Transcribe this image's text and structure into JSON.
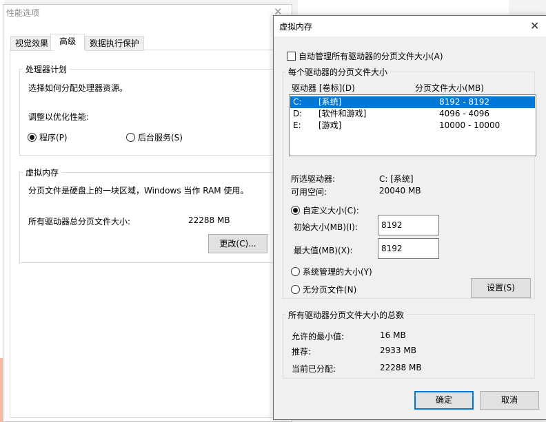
{
  "perf_window": {
    "title": "性能选项",
    "tabs": [
      "视觉效果",
      "高级",
      "数据执行保护"
    ],
    "cpu_group": {
      "title": "处理器计划",
      "description": "选择如何分配处理器资源。",
      "adjust_label": "调整以优化性能:",
      "option_programs": "程序(P)",
      "option_background": "后台服务(S)"
    },
    "vm_group": {
      "title": "虚拟内存",
      "description": "分页文件是硬盘上的一块区域，Windows 当作 RAM 使用。",
      "total_label": "所有驱动器总分页文件大小:",
      "total_value": "22288 MB",
      "change_button": "更改(C)..."
    }
  },
  "vm_dialog": {
    "title": "虚拟内存",
    "auto_manage_label": "自动管理所有驱动器的分页文件大小(A)",
    "drives_group_title": "每个驱动器的分页文件大小",
    "drive_header_letter": "驱动器 [卷标](D)",
    "drive_header_size": "分页文件大小(MB)",
    "drives": [
      {
        "letter": "C:",
        "label": "[系统]",
        "size": "8192 - 8192",
        "selected": true
      },
      {
        "letter": "D:",
        "label": "[软件和游戏]",
        "size": "4096 - 4096",
        "selected": false
      },
      {
        "letter": "E:",
        "label": "[游戏]",
        "size": "10000 - 10000",
        "selected": false
      }
    ],
    "selected_drive_label": "所选驱动器:",
    "selected_drive_value": "C:  [系统]",
    "free_space_label": "可用空间:",
    "free_space_value": "20040 MB",
    "custom_size_label": "自定义大小(C):",
    "initial_size_label": "初始大小(MB)(I):",
    "initial_size_value": "8192",
    "max_size_label": "最大值(MB)(X):",
    "max_size_value": "8192",
    "system_managed_label": "系统管理的大小(Y)",
    "no_paging_label": "无分页文件(N)",
    "set_button": "设置(S)",
    "totals_group_title": "所有驱动器分页文件大小的总数",
    "min_allowed_label": "允许的最小值:",
    "min_allowed_value": "16 MB",
    "recommended_label": "推荐:",
    "recommended_value": "2933 MB",
    "currently_allocated_label": "当前已分配:",
    "currently_allocated_value": "22288 MB",
    "ok_button": "确定",
    "cancel_button": "取消"
  },
  "colors": {
    "selection": "#0078d7",
    "dialog_bg": "#f0f0f0",
    "button_bg": "#e1e1e1"
  }
}
